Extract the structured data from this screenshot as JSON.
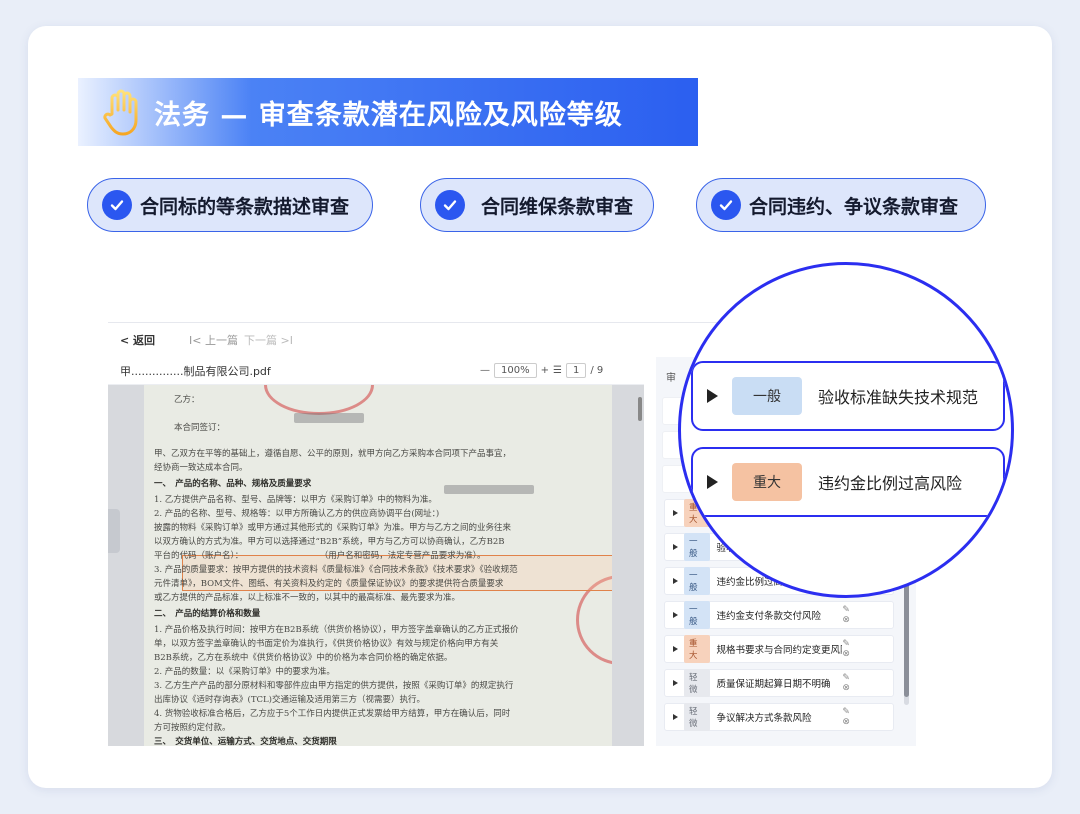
{
  "banner": {
    "title": "法务 — 审查条款潜在风险及风险等级",
    "icon": "hand-stop-icon"
  },
  "features": [
    {
      "label": "合同标的等条款描述审查",
      "icon": "check-circle-icon"
    },
    {
      "label": "合同维保条款审查",
      "icon": "check-circle-icon"
    },
    {
      "label": "合同违约、争议条款审查",
      "icon": "check-circle-icon"
    }
  ],
  "app": {
    "nav": {
      "back": "< 返回",
      "prev": "I< 上一篇",
      "next": "下一篇 >I"
    },
    "file_name": "甲...............制品有限公司.pdf",
    "zoom": {
      "minus": "—",
      "value": "100%",
      "plus": "+",
      "page": "1",
      "total": "/ 9"
    },
    "document_lines": [
      "乙方：",
      "本合同签订：",
      "甲、乙双方在平等的基础上，遵循自愿、公平的原则，就甲方向乙方采购本合同项下产品事宜，",
      "经协商一致达成本合同。",
      "一、　产品的名称、品种、规格及质量要求",
      "1. 乙方提供产品名称、型号、品牌等：以甲方《采购订单》中的物料为准。",
      "2. 产品的名称、型号、规格等：以甲方所确认乙方的供应商协调平台(网址：)",
      "披露的物料《采购订单》或甲方通过其他形式的《采购订单》为准。甲方与乙方之间的业务往来",
      "以双方确认的方式为准。甲方可以选择通过“B2B”系统，甲方与乙方可以协商确认，乙方B2B",
      "平台的代码（账户名）：　　　　　　　　　　（用户名和密码，法定专营产品要求为准）。",
      "3. 产品的质量要求：按甲方提供的技术资料《质量标准》《合同技术条款》《技术要求》《验收规范",
      "元件清单》，BOM文件、图纸、有关资料及约定的《质量保证协议》的要求提供符合质量要求",
      "或乙方提供的产品标准，以上标准不一致的，以其中的最高标准、最先要求为准。",
      "二、　产品的结算价格和数量",
      "1. 产品价格及执行时间：按甲方在B2B系统（供货价格协议），甲方签字盖章确认的乙方正式报价",
      "单，以双方签字盖章确认的书面定价为准执行，《供货价格协议》有效与规定价格向甲方有关",
      "B2B系统，乙方在系统中《供货价格协议》中的价格为本合同价格的确定依据。",
      "2. 产品的数量：以《采购订单》中的要求为准。",
      "3. 乙方生产产品的部分原材料和零部件应由甲方指定的供方提供，按照《采购订单》的规定执行",
      "出库协议《适时存询表》(TCL)交通运输及适用第三方（视需要）执行。",
      "4. 货物验收标准合格后，乙方应于5个工作日内提供正式发票给甲方结算，甲方在确认后，同时",
      "方可按照约定付款。",
      "三、　交货单位、运输方式、交货地点、交货期限",
      "1. 交货单位：乙方；"
    ],
    "panel": {
      "header": "审",
      "risks": [
        {
          "level": "重大",
          "text": "约定的违约金比例偏高风险",
          "icons": "✎ ⊗"
        },
        {
          "level": "一般",
          "text": "验收标准的时间约定不明确",
          "icons": "✎ ⊗"
        },
        {
          "level": "一般",
          "text": "违约金比例过高风险",
          "icons": "✎ ⊗"
        },
        {
          "level": "一般",
          "text": "违约金支付条款交付风险",
          "icons": "✎ ⊗"
        },
        {
          "level": "重大",
          "text": "规格书要求与合同约定变更风险",
          "icons": "✎ ⊗"
        },
        {
          "level": "轻微",
          "text": "质量保证期起算日期不明确",
          "icons": "✎ ⊗"
        },
        {
          "level": "轻微",
          "text": "争议解决方式条款风险",
          "icons": "✎ ⊗"
        }
      ]
    }
  },
  "magnified": [
    {
      "level": "一般",
      "text": "验收标准缺失技术规范",
      "badge_color": "#c9ddf4"
    },
    {
      "level": "重大",
      "text": "违约金比例过高风险",
      "badge_color": "#f5c2a2"
    }
  ],
  "colors": {
    "accent": "#2b57f0",
    "ring": "#2b2ef0",
    "normal_badge": "#c9ddf4",
    "major_badge": "#f5c2a2"
  }
}
